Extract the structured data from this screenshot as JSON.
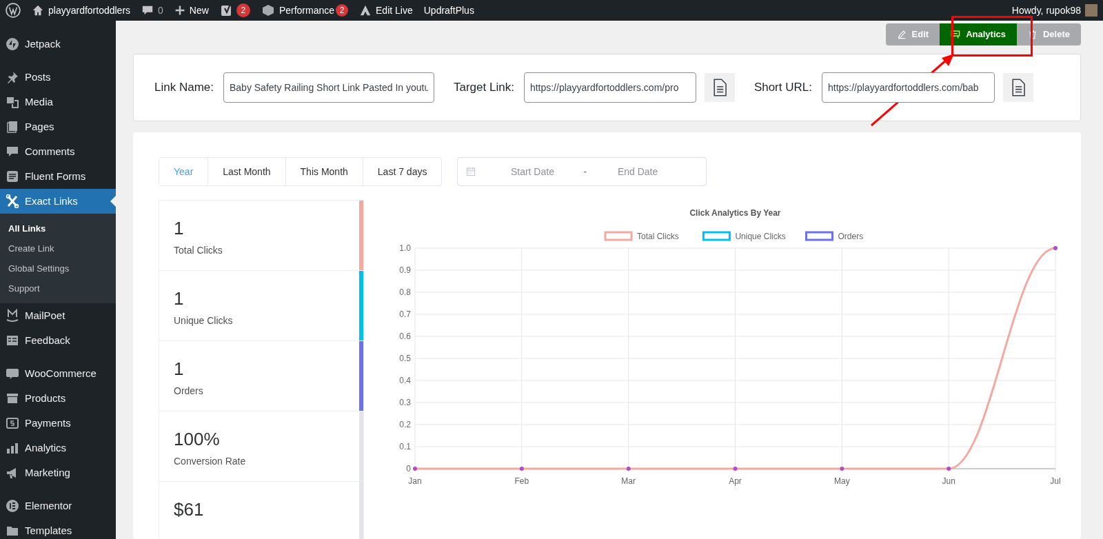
{
  "admin_bar": {
    "site": "playyardfortoddlers",
    "comments": "0",
    "new": "New",
    "yoast_badge": "2",
    "performance": "Performance",
    "performance_badge": "2",
    "edit_live": "Edit Live",
    "updraft": "UpdraftPlus",
    "howdy": "Howdy, rupok98"
  },
  "sidebar": {
    "items": [
      {
        "label": "Jetpack",
        "selected": false
      },
      {
        "label": "Posts",
        "selected": false
      },
      {
        "label": "Media",
        "selected": false
      },
      {
        "label": "Pages",
        "selected": false
      },
      {
        "label": "Comments",
        "selected": false
      },
      {
        "label": "Fluent Forms",
        "selected": false
      },
      {
        "label": "Exact Links",
        "selected": true,
        "children": [
          {
            "label": "All Links",
            "selected": true
          },
          {
            "label": "Create Link",
            "selected": false
          },
          {
            "label": "Global Settings",
            "selected": false
          },
          {
            "label": "Support",
            "selected": false
          }
        ]
      },
      {
        "label": "MailPoet",
        "selected": false
      },
      {
        "label": "Feedback",
        "selected": false
      },
      {
        "label": "WooCommerce",
        "selected": false
      },
      {
        "label": "Products",
        "selected": false
      },
      {
        "label": "Payments",
        "selected": false
      },
      {
        "label": "Analytics",
        "selected": false
      },
      {
        "label": "Marketing",
        "selected": false
      },
      {
        "label": "Elementor",
        "selected": false
      },
      {
        "label": "Templates",
        "selected": false
      }
    ]
  },
  "actions": [
    {
      "label": "Edit",
      "selected": false
    },
    {
      "label": "Analytics",
      "selected": true
    },
    {
      "label": "Delete",
      "selected": false
    }
  ],
  "link_fields": [
    {
      "label": "Link Name:",
      "value": "Baby Safety Railing Short Link Pasted In youtu"
    },
    {
      "label": "Target Link:",
      "value": "https://playyardfortoddlers.com/pro"
    },
    {
      "label": "Short URL:",
      "value": "https://playyardfortoddlers.com/bab"
    }
  ],
  "period_tabs": [
    {
      "label": "Year",
      "selected": true
    },
    {
      "label": "Last Month",
      "selected": false
    },
    {
      "label": "This Month",
      "selected": false
    },
    {
      "label": "Last 7 days",
      "selected": false
    }
  ],
  "date_range": {
    "start_placeholder": "Start Date",
    "separator": "-",
    "end_placeholder": "End Date"
  },
  "stats": [
    {
      "value": "1",
      "label": "Total Clicks",
      "color": "#f4a9a0"
    },
    {
      "value": "1",
      "label": "Unique Clicks",
      "color": "#00c0ef"
    },
    {
      "value": "1",
      "label": "Orders",
      "color": "#6b72f0"
    },
    {
      "value": "100%",
      "label": "Conversion Rate",
      "color": "#e2e4e7"
    },
    {
      "value": "$61",
      "color": "#e2e4e7"
    }
  ],
  "chart": {
    "chart_data": {
      "type": "line",
      "title": "Click Analytics By Year",
      "categories": [
        "Jan",
        "Feb",
        "Mar",
        "Apr",
        "May",
        "Jun",
        "Jul"
      ],
      "series": [
        {
          "name": "Total Clicks",
          "color": "#f4a9a0",
          "marker": "circle",
          "values": [
            0,
            0,
            0,
            0,
            0,
            0,
            1
          ]
        },
        {
          "name": "Unique Clicks",
          "color": "#00c0ef",
          "values": [
            null,
            null,
            null,
            null,
            null,
            null,
            null
          ]
        },
        {
          "name": "Orders",
          "color": "#6b72f0",
          "values": [
            null,
            null,
            null,
            null,
            null,
            null,
            null
          ]
        }
      ],
      "grid": true,
      "legend": true,
      "ylim": [
        0,
        1
      ],
      "yticks": [
        {
          "value": 0,
          "label": "0"
        },
        {
          "value": 0.1,
          "label": "0.1"
        },
        {
          "value": 0.2,
          "label": "0.2"
        },
        {
          "value": 0.3,
          "label": "0.3"
        },
        {
          "value": 0.4,
          "label": "0.4"
        },
        {
          "value": 0.5,
          "label": "0.5"
        },
        {
          "value": 0.6,
          "label": "0.6"
        },
        {
          "value": 0.7,
          "label": "0.7"
        },
        {
          "value": 0.8,
          "label": "0.8"
        },
        {
          "value": 0.9,
          "label": "0.9"
        },
        {
          "value": 1,
          "label": "1.0"
        }
      ]
    }
  }
}
